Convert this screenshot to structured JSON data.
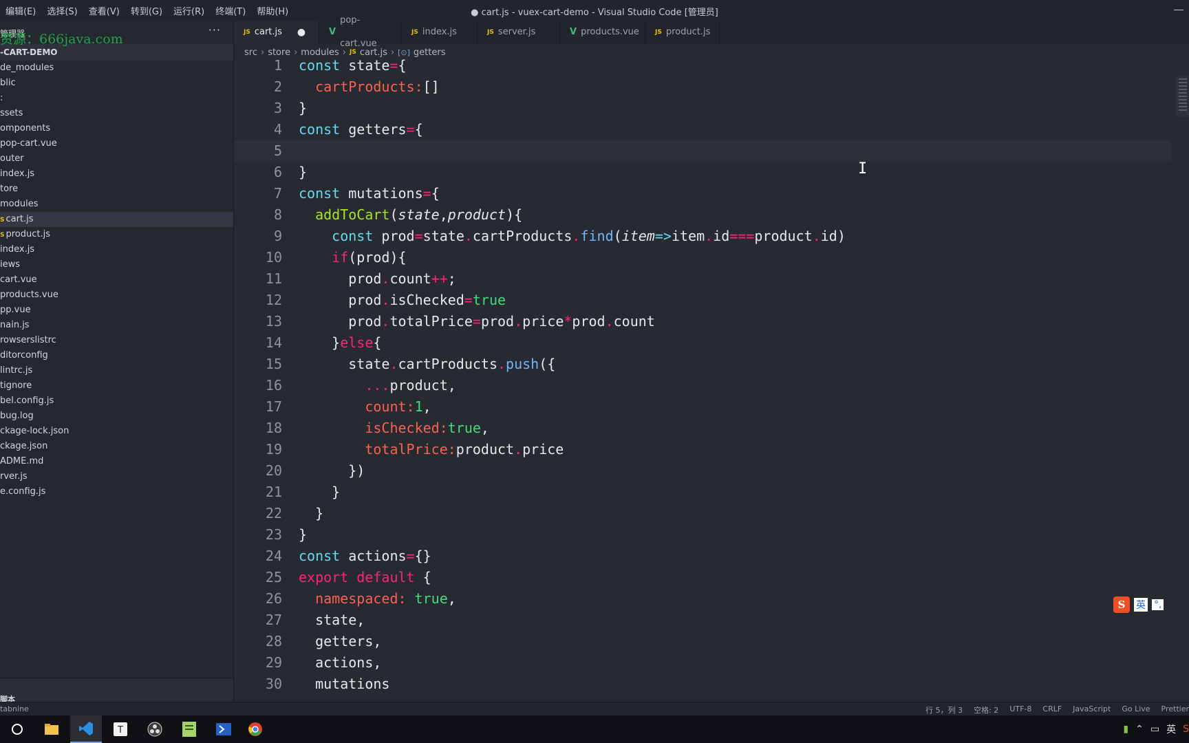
{
  "menu": [
    "编辑(E)",
    "选择(S)",
    "查看(V)",
    "转到(G)",
    "运行(R)",
    "终端(T)",
    "帮助(H)"
  ],
  "window_title": "● cart.js - vuex-cart-demo - Visual Studio Code [管理员]",
  "sidebar": {
    "explorer_label": "管理器",
    "watermark": "资源：666java.com",
    "more": "···",
    "project": "-CART-DEMO",
    "items": [
      {
        "label": "de_modules",
        "icon": ""
      },
      {
        "label": "blic",
        "icon": ""
      },
      {
        "label": ":",
        "icon": ""
      },
      {
        "label": "ssets",
        "icon": ""
      },
      {
        "label": "omponents",
        "icon": ""
      },
      {
        "label": "pop-cart.vue",
        "icon": ""
      },
      {
        "label": "outer",
        "icon": ""
      },
      {
        "label": "index.js",
        "icon": ""
      },
      {
        "label": "tore",
        "icon": ""
      },
      {
        "label": "modules",
        "icon": ""
      },
      {
        "label": "cart.js",
        "icon": "JS",
        "active": true
      },
      {
        "label": "product.js",
        "icon": "JS"
      },
      {
        "label": "index.js",
        "icon": ""
      },
      {
        "label": "iews",
        "icon": ""
      },
      {
        "label": "cart.vue",
        "icon": ""
      },
      {
        "label": "products.vue",
        "icon": ""
      },
      {
        "label": "pp.vue",
        "icon": ""
      },
      {
        "label": "nain.js",
        "icon": ""
      },
      {
        "label": "rowserslistrc",
        "icon": ""
      },
      {
        "label": "ditorconfig",
        "icon": ""
      },
      {
        "label": "lintrc.js",
        "icon": ""
      },
      {
        "label": "tignore",
        "icon": ""
      },
      {
        "label": "bel.config.js",
        "icon": ""
      },
      {
        "label": "bug.log",
        "icon": ""
      },
      {
        "label": "ckage-lock.json",
        "icon": ""
      },
      {
        "label": "ckage.json",
        "icon": ""
      },
      {
        "label": "ADME.md",
        "icon": ""
      },
      {
        "label": "rver.js",
        "icon": ""
      },
      {
        "label": "e.config.js",
        "icon": ""
      }
    ],
    "outline_label": "脚本"
  },
  "tabs": [
    {
      "label": "cart.js",
      "kind": "js",
      "active": true,
      "dirty": "●"
    },
    {
      "label": "pop-cart.vue",
      "kind": "vue"
    },
    {
      "label": "index.js",
      "kind": "js"
    },
    {
      "label": "server.js",
      "kind": "js"
    },
    {
      "label": "products.vue",
      "kind": "vue"
    },
    {
      "label": "product.js",
      "kind": "js"
    }
  ],
  "breadcrumb": [
    "src",
    "store",
    "modules",
    "cart.js",
    "getters"
  ],
  "code_lines": [
    "1",
    "2",
    "3",
    "4",
    "5",
    "6",
    "7",
    "8",
    "9",
    "10",
    "11",
    "12",
    "13",
    "14",
    "15",
    "16",
    "17",
    "18",
    "19",
    "20",
    "21",
    "22",
    "23",
    "24",
    "25",
    "26",
    "27",
    "28",
    "29",
    "30"
  ],
  "status": {
    "left": "tabnine",
    "position": "行 5，列 3",
    "spaces": "空格: 2",
    "encoding": "UTF-8",
    "eol": "CRLF",
    "language": "JavaScript",
    "golive": "Go Live",
    "prettier": "Prettier"
  },
  "ime": {
    "mode": "英",
    "extra": "°,"
  },
  "tray": {
    "lang": "英"
  }
}
